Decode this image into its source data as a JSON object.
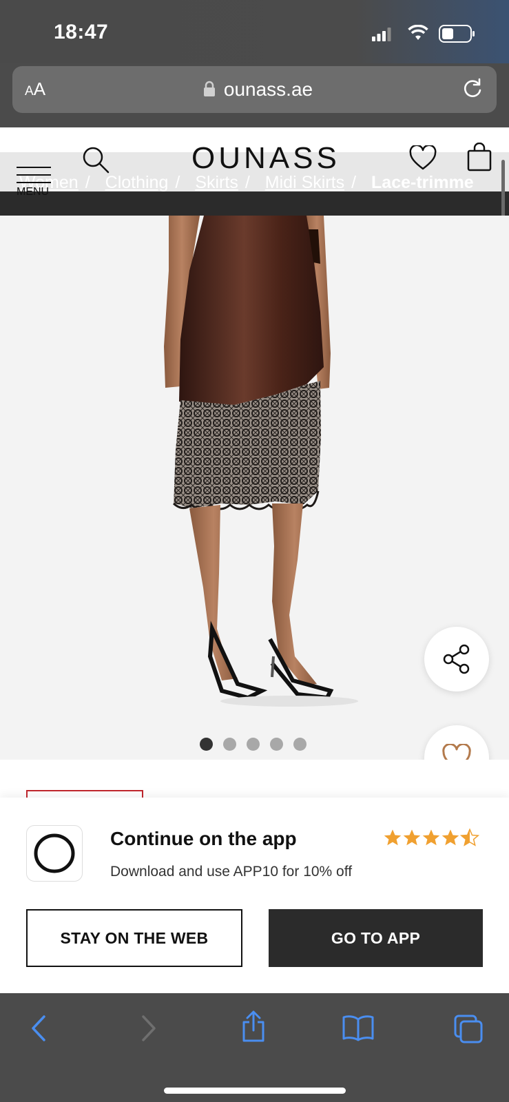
{
  "status_bar": {
    "time": "18:47"
  },
  "browser": {
    "aa_label_small": "A",
    "aa_label_large": "A",
    "url": "ounass.ae"
  },
  "header": {
    "menu_label": "MENU",
    "logo": "OUNASS",
    "breadcrumb": [
      {
        "label": "Women",
        "sep": "/"
      },
      {
        "label": "Clothing",
        "sep": "/"
      },
      {
        "label": "Skirts",
        "sep": "/"
      },
      {
        "label": "Midi Skirts",
        "sep": "/"
      }
    ],
    "breadcrumb_current": "Lace-trimme"
  },
  "product": {
    "image_dots_total": 5,
    "image_dots_active": 1
  },
  "app_banner": {
    "title": "Continue on the app",
    "subtitle": "Download and use APP10 for 10% off",
    "rating": 4.5,
    "rating_color": "#f0a030",
    "stay_button": "STAY ON THE WEB",
    "go_button": "GO TO APP"
  },
  "toolbar": {
    "icons": [
      "back-icon",
      "forward-icon",
      "share-icon",
      "bookmarks-icon",
      "tabs-icon"
    ],
    "accent": "#4a8ef0"
  }
}
